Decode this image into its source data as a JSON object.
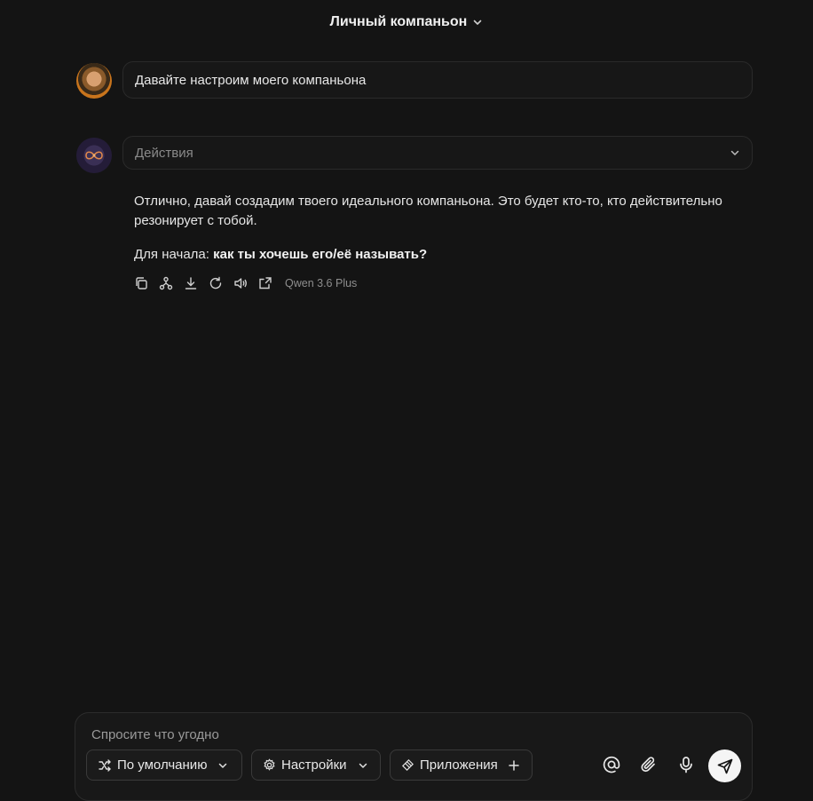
{
  "header": {
    "title": "Личный компаньон"
  },
  "messages": {
    "user": {
      "text": "Давайте настроим моего компаньона"
    },
    "assistant": {
      "actions_label": "Действия",
      "paragraph1": "Отлично, давай создадим твоего идеального компаньона. Это будет кто-то, кто действительно резонирует с тобой.",
      "paragraph2_prefix": "Для начала: ",
      "paragraph2_bold": "как ты хочешь его/её называть?",
      "model": "Qwen 3.6 Plus"
    }
  },
  "toolbar_icons": [
    "copy-icon",
    "share-branch-icon",
    "download-icon",
    "regenerate-icon",
    "speaker-icon",
    "export-icon"
  ],
  "composer": {
    "placeholder": "Спросите что угодно",
    "mode_label": "По умолчанию",
    "settings_label": "Настройки",
    "apps_label": "Приложения"
  }
}
